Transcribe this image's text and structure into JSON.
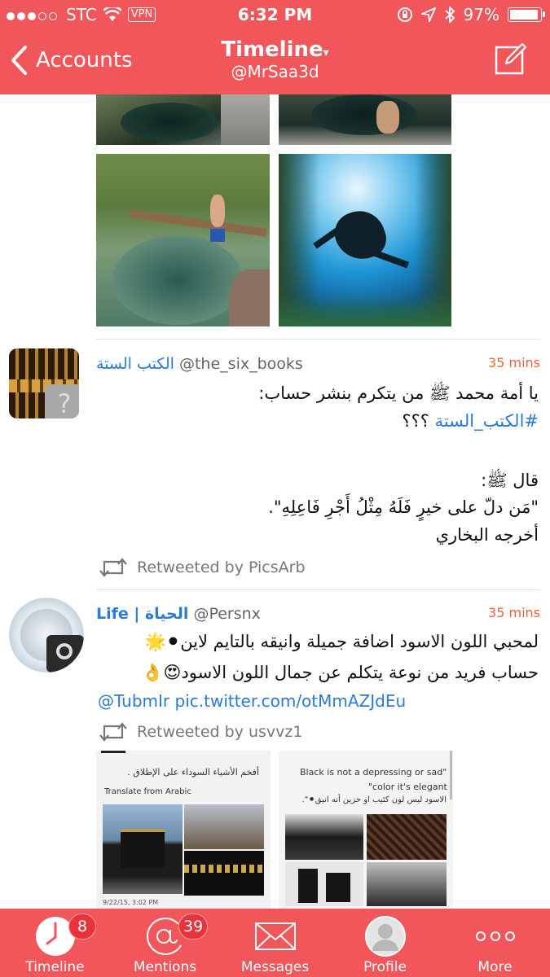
{
  "status_bar": {
    "carrier": "STC",
    "vpn": "VPN",
    "time": "6:32 PM",
    "battery": "97%"
  },
  "nav": {
    "back_label": "Accounts",
    "title": "Timeline",
    "title_arrow": "▾",
    "subtitle": "@MrSaa3d"
  },
  "tweets": [
    {
      "display_name": "الكتب الستة",
      "handle": "@the_six_books",
      "time": "35 mins",
      "lines": [
        "يا أمة محمد ﷺ من يتكرم بنشر حساب:",
        "#الكتب_الستة ؟؟؟",
        "",
        "قال ﷺ:",
        "\"مَن دلّ على خيرٍ فَلَهُ مِثْلُ أَجْرِ فَاعِلِهِ\".",
        "أخرجه البخاري"
      ],
      "hashtag": "#الكتب_الستة",
      "hashtag_rest": " ؟؟؟",
      "retweeted_by": "Retweeted by PicsArb"
    },
    {
      "display_name": "Life | الحياة",
      "handle": "@Persnx",
      "time": "35 mins",
      "lines": [
        "لمحبي اللون الاسود اضافة جميلة وانيقه بالتايم لاين⚫🌟",
        "حساب فريد من نوعة يتكلم عن جمال اللون  الاسود😍👌"
      ],
      "link": "@TubmIr pic.twitter.com/otMmAZJdEu",
      "retweeted_by": "Retweeted by usvvz1"
    }
  ],
  "media_texts": {
    "left_caption": "أفخم الأشياء السوداء على الإطلاق .",
    "translate": "Translate from Arabic",
    "date": "9/22/15, 3:02 PM",
    "right_en_1": "Black is not a depressing or sad\"",
    "right_en_2": "\"color it's elegant",
    "right_ar": "الاسود ليس لون كئيب او حزين أنه انيق⚫\"."
  },
  "tabs": [
    {
      "label": "Timeline",
      "badge": "8"
    },
    {
      "label": "Mentions",
      "badge": "39"
    },
    {
      "label": "Messages",
      "badge": ""
    },
    {
      "label": "Profile",
      "badge": ""
    },
    {
      "label": "More",
      "badge": ""
    }
  ],
  "colors": {
    "accent": "#f0565a",
    "link": "#2a7ad8",
    "time": "#e5673a"
  }
}
